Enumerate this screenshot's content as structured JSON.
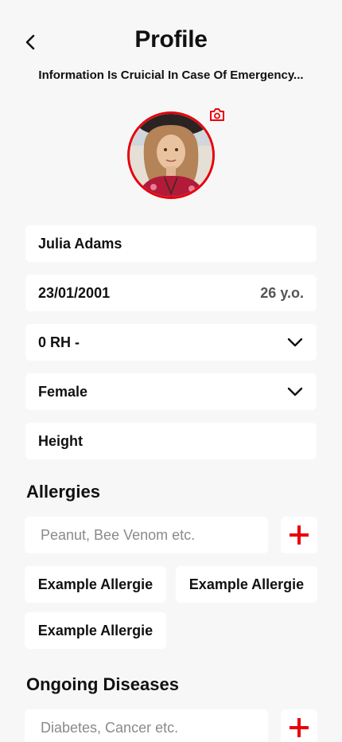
{
  "header": {
    "title": "Profile",
    "subtitle": "Information Is Cruicial In Case Of Emergency...",
    "back_icon": "chevron-left-icon"
  },
  "profile": {
    "camera_icon": "camera-icon",
    "accent_color": "#e8000a"
  },
  "fields": {
    "name": "Julia Adams",
    "birthdate": "23/01/2001",
    "age": "26 y.o.",
    "blood_type": "0 RH -",
    "gender": "Female",
    "height_placeholder": "Height"
  },
  "allergies": {
    "title": "Allergies",
    "placeholder": "Peanut, Bee Venom etc.",
    "items": [
      "Example Allergie",
      "Example Allergie",
      "Example Allergie"
    ]
  },
  "diseases": {
    "title": "Ongoing Diseases",
    "placeholder": "Diabetes, Cancer etc."
  }
}
